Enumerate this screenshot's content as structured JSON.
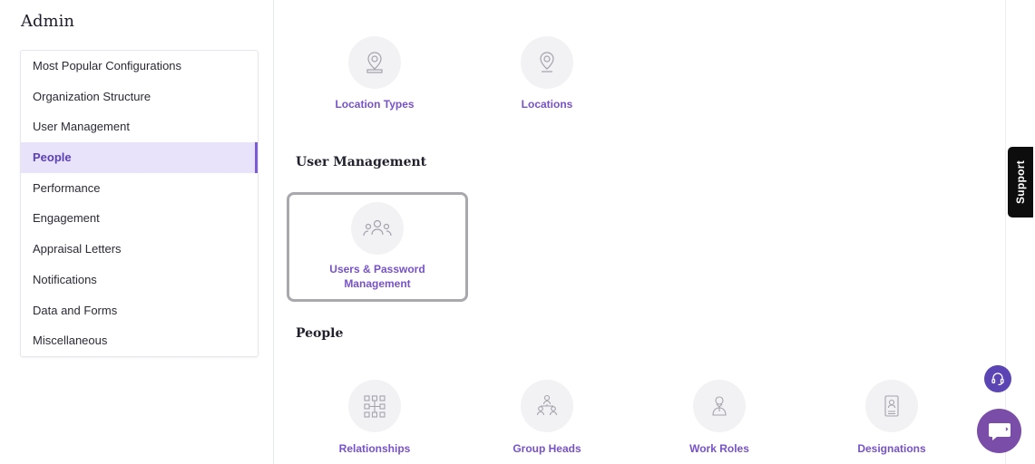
{
  "sidebar": {
    "title": "Admin",
    "items": [
      {
        "label": "Most Popular Configurations"
      },
      {
        "label": "Organization Structure"
      },
      {
        "label": "User Management"
      },
      {
        "label": "People"
      },
      {
        "label": "Performance"
      },
      {
        "label": "Engagement"
      },
      {
        "label": "Appraisal Letters"
      },
      {
        "label": "Notifications"
      },
      {
        "label": "Data and Forms"
      },
      {
        "label": "Miscellaneous"
      }
    ],
    "active_item": "People"
  },
  "main": {
    "location_tiles": [
      {
        "label": "Location Types",
        "icon": "location-badge-icon"
      },
      {
        "label": "Locations",
        "icon": "map-pin-icon"
      }
    ],
    "user_management": {
      "heading": "User Management",
      "tiles": [
        {
          "label_line1": "Users & Password",
          "label_line2": "Management",
          "icon": "users-group-icon"
        }
      ]
    },
    "people": {
      "heading": "People",
      "tiles": [
        {
          "label": "Relationships",
          "icon": "hierarchy-icon"
        },
        {
          "label": "Group Heads",
          "icon": "group-head-icon"
        },
        {
          "label": "Work Roles",
          "icon": "work-role-icon"
        },
        {
          "label": "Designations",
          "icon": "id-card-icon"
        }
      ]
    }
  },
  "support": {
    "label": "Support"
  },
  "colors": {
    "accent": "#7752c8",
    "active_bg": "#e8e3fb",
    "chat_button": "#7a4ea8",
    "headset_button": "#5b45b5"
  }
}
